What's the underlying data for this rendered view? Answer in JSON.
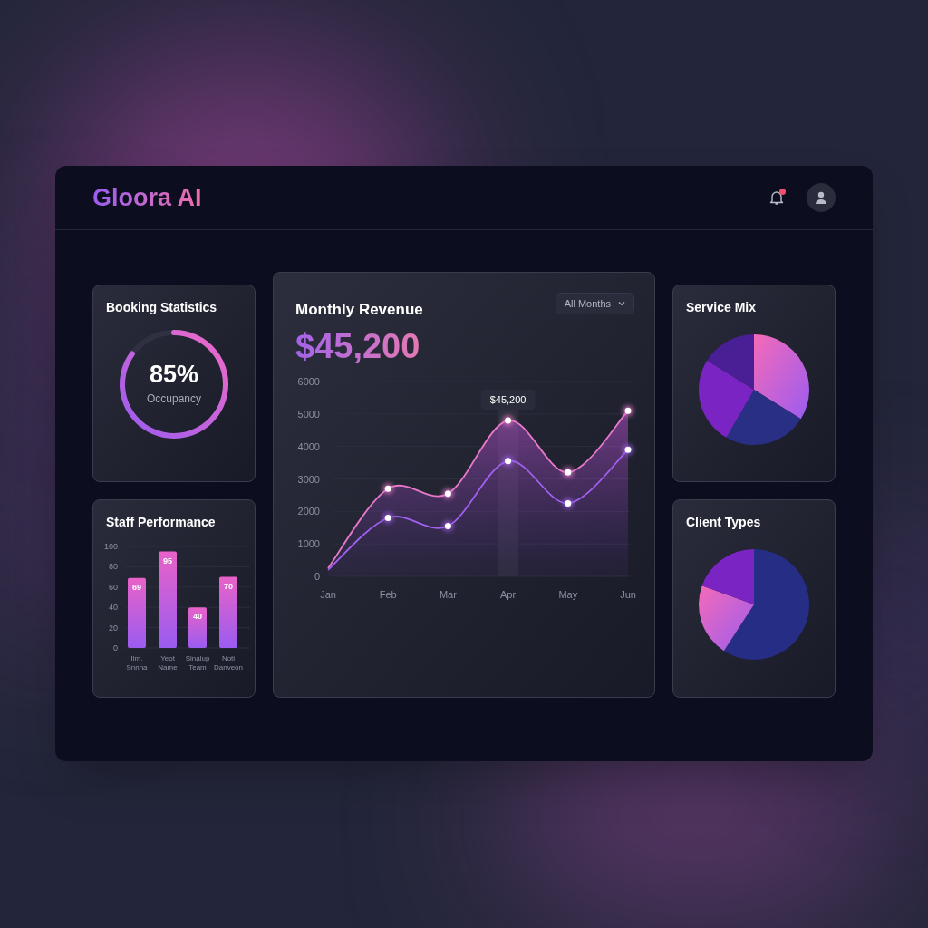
{
  "header": {
    "logo": "Gloora AI",
    "notifications": {
      "unread": true
    }
  },
  "booking_statistics": {
    "title": "Booking Statistics",
    "value": "85%",
    "label": "Occupancy"
  },
  "staff_performance": {
    "title": "Staff Performance",
    "chart_data": {
      "type": "bar",
      "categories": [
        "Ilm. Snnha",
        "Yeot Name",
        "Sinalup Team",
        "Noti Danveon"
      ],
      "values": [
        69,
        95,
        40,
        70
      ],
      "data_labels": true,
      "grid": true,
      "ylim": [
        0,
        100
      ],
      "yticks": [
        0,
        20,
        40,
        60,
        80,
        100
      ]
    }
  },
  "monthly_revenue": {
    "title": "Monthly Revenue",
    "amount": "$45,200",
    "filter": "All Months",
    "chart_data": {
      "type": "line",
      "grid": true,
      "categories": [
        "Jan",
        "Feb",
        "Mar",
        "Apr",
        "May",
        "Jun"
      ],
      "series": [
        {
          "type": "area",
          "marker": "o",
          "color": "#e879c9",
          "values": [
            250,
            2700,
            2550,
            4800,
            3200,
            5100
          ]
        },
        {
          "type": "line",
          "marker": "o",
          "color": "#a160f0",
          "values": [
            200,
            1800,
            1550,
            3550,
            2250,
            3900
          ]
        }
      ],
      "ylim": [
        0,
        6000
      ],
      "yticks": [
        0,
        1000,
        2000,
        3000,
        4000,
        5000,
        6000
      ],
      "annotations": [
        {
          "x": "Apr",
          "y": 4800,
          "text": "$45,200"
        }
      ]
    }
  },
  "service_mix": {
    "title": "Service Mix"
  },
  "client_types": {
    "title": "Client Types"
  }
}
